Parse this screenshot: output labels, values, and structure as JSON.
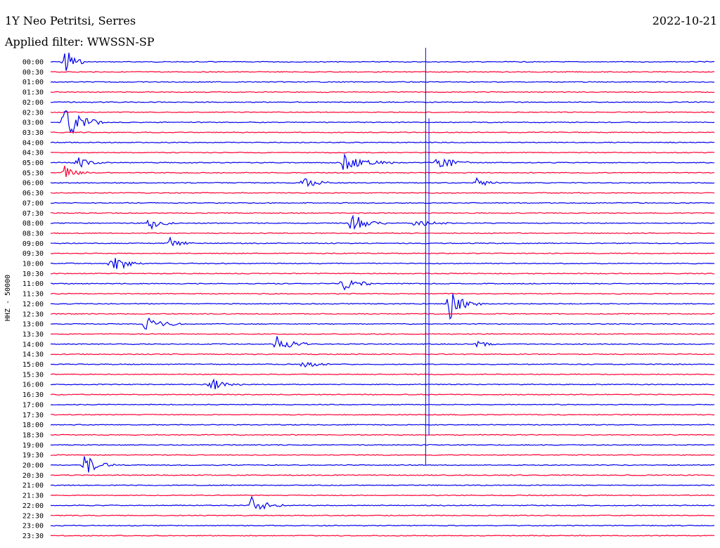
{
  "header": {
    "station": "1Y Neo Petritsi, Serres",
    "date": "2022-10-21",
    "filter": "Applied filter: WWSSN-SP"
  },
  "colors": {
    "odd_trace": "#0000ee",
    "even_trace": "#ff0033"
  },
  "chart_data": {
    "type": "helicorder",
    "ylabel": "HHZ - 50000",
    "row_labels": [
      "00:00",
      "00:30",
      "01:00",
      "01:30",
      "02:00",
      "02:30",
      "03:00",
      "03:30",
      "04:00",
      "04:30",
      "05:00",
      "05:30",
      "06:00",
      "06:30",
      "07:00",
      "07:30",
      "08:00",
      "08:30",
      "09:00",
      "09:30",
      "10:00",
      "10:30",
      "11:00",
      "11:30",
      "12:00",
      "12:30",
      "13:00",
      "13:30",
      "14:00",
      "14:30",
      "15:00",
      "15:30",
      "16:00",
      "16:30",
      "17:00",
      "17:30",
      "18:00",
      "18:30",
      "19:00",
      "19:30",
      "20:00",
      "20:30",
      "21:00",
      "21:30",
      "22:00",
      "22:30",
      "23:00",
      "23:30"
    ],
    "trace_colors_alternate": [
      "blue",
      "red"
    ],
    "events": [
      {
        "row": 0,
        "t": 0.02,
        "amp": 6,
        "dur": 0.03
      },
      {
        "row": 6,
        "t": 0.02,
        "amp": 5.5,
        "dur": 0.06
      },
      {
        "row": 10,
        "t": 0.04,
        "amp": 1.8,
        "dur": 0.04
      },
      {
        "row": 10,
        "t": 0.58,
        "amp": 3.2,
        "dur": 0.05
      },
      {
        "row": 10,
        "t": 0.44,
        "amp": 2.5,
        "dur": 0.08
      },
      {
        "row": 11,
        "t": 0.02,
        "amp": 2.2,
        "dur": 0.04
      },
      {
        "row": 12,
        "t": 0.38,
        "amp": 1.7,
        "dur": 0.05
      },
      {
        "row": 12,
        "t": 0.64,
        "amp": 1.5,
        "dur": 0.04
      },
      {
        "row": 16,
        "t": 0.15,
        "amp": 2.2,
        "dur": 0.04
      },
      {
        "row": 16,
        "t": 0.45,
        "amp": 3.2,
        "dur": 0.06
      },
      {
        "row": 16,
        "t": 0.55,
        "amp": 1.5,
        "dur": 0.05
      },
      {
        "row": 18,
        "t": 0.18,
        "amp": 1.5,
        "dur": 0.04
      },
      {
        "row": 20,
        "t": 0.09,
        "amp": 3.5,
        "dur": 0.05
      },
      {
        "row": 22,
        "t": 0.44,
        "amp": 2.5,
        "dur": 0.05
      },
      {
        "row": 24,
        "t": 0.6,
        "amp": 5,
        "dur": 0.05
      },
      {
        "row": 26,
        "t": 0.14,
        "amp": 2.7,
        "dur": 0.06
      },
      {
        "row": 28,
        "t": 0.34,
        "amp": 2.4,
        "dur": 0.06
      },
      {
        "row": 28,
        "t": 0.64,
        "amp": 1.3,
        "dur": 0.04
      },
      {
        "row": 30,
        "t": 0.38,
        "amp": 1.5,
        "dur": 0.04
      },
      {
        "row": 32,
        "t": 0.24,
        "amp": 2.0,
        "dur": 0.05
      },
      {
        "row": 40,
        "t": 0.05,
        "amp": 3.0,
        "dur": 0.05
      },
      {
        "row": 44,
        "t": 0.3,
        "amp": 3.0,
        "dur": 0.05
      }
    ],
    "xlim": [
      0,
      1
    ],
    "grid": false
  }
}
